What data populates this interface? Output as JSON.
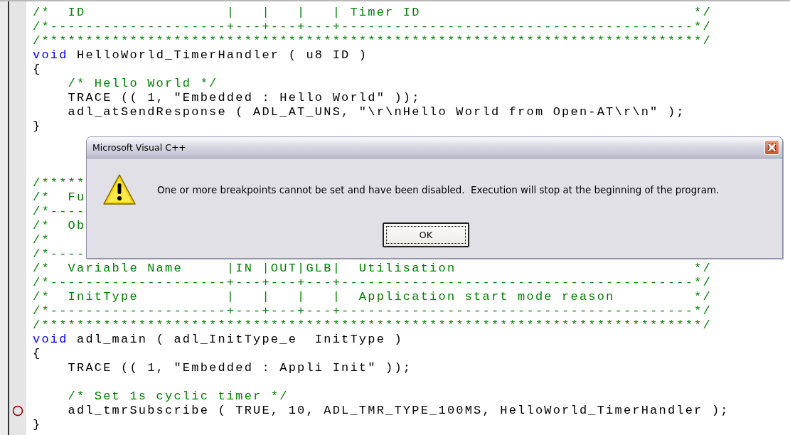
{
  "editor": {
    "lines": [
      {
        "kind": "comment",
        "text": "/*  ID                |   |   |   | Timer ID                               */",
        "breakpoint": false
      },
      {
        "kind": "comment",
        "text": "/*--------------------+---+---+---+----------------------------------------*/",
        "breakpoint": false
      },
      {
        "kind": "comment",
        "text": "/***************************************************************************/",
        "breakpoint": false
      },
      {
        "kind": "code",
        "keyword": "void",
        "text": " HelloWorld_TimerHandler ( u8 ID )",
        "breakpoint": false
      },
      {
        "kind": "code",
        "text": "{",
        "breakpoint": false
      },
      {
        "kind": "comment",
        "text": "    /* Hello World */",
        "breakpoint": false
      },
      {
        "kind": "code",
        "text": "    TRACE (( 1, \"Embedded : Hello World\" ));",
        "breakpoint": false
      },
      {
        "kind": "code",
        "text": "    adl_atSendResponse ( ADL_AT_UNS, \"\\r\\nHello World from Open-AT\\r\\n\" );",
        "breakpoint": false
      },
      {
        "kind": "code",
        "text": "}",
        "breakpoint": false
      },
      {
        "kind": "blank"
      },
      {
        "kind": "blank"
      },
      {
        "kind": "blank"
      },
      {
        "kind": "comment",
        "text": "/*****",
        "breakpoint": false
      },
      {
        "kind": "comment",
        "text": "/*  Fu",
        "breakpoint": false
      },
      {
        "kind": "comment",
        "text": "/*----",
        "breakpoint": false
      },
      {
        "kind": "comment",
        "text": "/*  Ob",
        "breakpoint": false
      },
      {
        "kind": "comment",
        "text": "/*",
        "breakpoint": false
      },
      {
        "kind": "comment",
        "text": "/*----",
        "breakpoint": false
      },
      {
        "kind": "comment",
        "text": "/*  Variable Name     |IN |OUT|GLB|  Utilisation                           */",
        "breakpoint": false
      },
      {
        "kind": "comment",
        "text": "/*--------------------+---+---+---+----------------------------------------*/",
        "breakpoint": false
      },
      {
        "kind": "comment",
        "text": "/*  InitType          |   |   |   |  Application start mode reason         */",
        "breakpoint": false
      },
      {
        "kind": "comment",
        "text": "/*--------------------+---+---+---+----------------------------------------*/",
        "breakpoint": false
      },
      {
        "kind": "comment",
        "text": "/***************************************************************************/",
        "breakpoint": false
      },
      {
        "kind": "code",
        "keyword": "void",
        "text": " adl_main ( adl_InitType_e  InitType )",
        "breakpoint": false
      },
      {
        "kind": "code",
        "text": "{",
        "breakpoint": false
      },
      {
        "kind": "code",
        "text": "    TRACE (( 1, \"Embedded : Appli Init\" ));",
        "breakpoint": false
      },
      {
        "kind": "blank"
      },
      {
        "kind": "comment",
        "text": "    /* Set 1s cyclic timer */",
        "breakpoint": false
      },
      {
        "kind": "code",
        "text": "    adl_tmrSubscribe ( TRUE, 10, ADL_TMR_TYPE_100MS, HelloWorld_TimerHandler );",
        "breakpoint": true
      },
      {
        "kind": "code",
        "text": "}",
        "breakpoint": false
      }
    ]
  },
  "dialog": {
    "title": "Microsoft Visual C++",
    "message": "One or more breakpoints cannot be set and have been disabled.  Execution will stop at the beginning of the program.",
    "buttons": [
      {
        "label": "OK",
        "focused": true
      }
    ]
  }
}
